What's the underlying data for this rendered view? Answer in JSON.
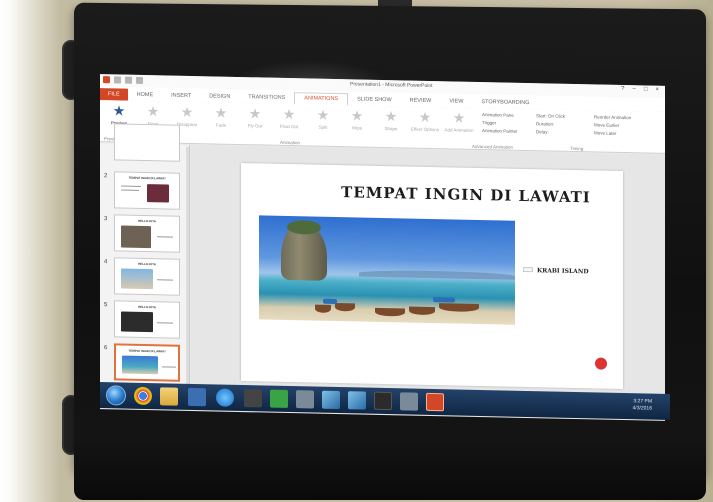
{
  "window": {
    "title": "Presentation1 - Microsoft PowerPoint",
    "controls": [
      "?",
      "–",
      "□",
      "×"
    ],
    "sign_in": "Sign in"
  },
  "tabs": [
    "FILE",
    "HOME",
    "INSERT",
    "DESIGN",
    "TRANSITIONS",
    "ANIMATIONS",
    "SLIDE SHOW",
    "REVIEW",
    "VIEW",
    "STORYBOARDING"
  ],
  "active_tab": "ANIMATIONS",
  "ribbon": {
    "preview": "Preview",
    "animations": [
      "None",
      "Disappear",
      "Fade",
      "Fly Out",
      "Float Out",
      "Split",
      "Wipe",
      "Shape"
    ],
    "effect_options": "Effect Options",
    "add_animation": "Add Animation",
    "advanced": [
      "Animation Pane",
      "Trigger",
      "Animation Painter"
    ],
    "timing": [
      "Start: On Click",
      "Duration:",
      "Delay:"
    ],
    "reorder": [
      "Reorder Animation",
      "Move Earlier",
      "Move Later"
    ],
    "groups": [
      "Preview",
      "Animation",
      "Advanced Animation",
      "Timing"
    ]
  },
  "thumbnails": [
    {
      "num": "",
      "title": ""
    },
    {
      "num": "2",
      "title": "TEMPAT INGIN DI LAWATI"
    },
    {
      "num": "3",
      "title": "HELLO KITA"
    },
    {
      "num": "4",
      "title": "HELLO KITA"
    },
    {
      "num": "5",
      "title": "HELLO KITA"
    },
    {
      "num": "6",
      "title": "TEMPAT INGIN DI LAWATI"
    }
  ],
  "slide": {
    "title": "TEMPAT INGIN DI LAWATI",
    "caption": "KRABI ISLAND"
  },
  "statusbar": {
    "slide_info": "SLIDE 6 OF 6",
    "notes": "NOTES",
    "comments": "COMMENTS",
    "zoom": "76%"
  },
  "taskbar": {
    "time": "3:27 PM",
    "date": "4/3/2016"
  }
}
